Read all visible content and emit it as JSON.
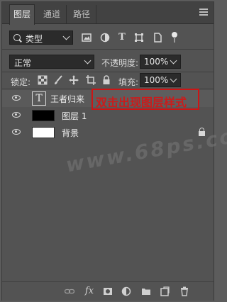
{
  "tabs": [
    {
      "label": "图层",
      "active": true
    },
    {
      "label": "通道",
      "active": false
    },
    {
      "label": "路径",
      "active": false
    }
  ],
  "filter": {
    "type_label": "类型",
    "icons": [
      "image-filter-icon",
      "adjustment-filter-icon",
      "text-filter-icon",
      "shape-filter-icon",
      "smart-object-filter-icon"
    ]
  },
  "blend": {
    "mode": "正常",
    "opacity_label": "不透明度:",
    "opacity_value": "100%"
  },
  "locks": {
    "label": "锁定:",
    "fill_label": "填充:",
    "fill_value": "100%"
  },
  "layers": [
    {
      "name": "王者归来",
      "kind": "text",
      "visible": true,
      "thumb_glyph": "T"
    },
    {
      "name": "图层 1",
      "kind": "pixel",
      "visible": true,
      "thumb_color": "#000000"
    },
    {
      "name": "背景",
      "kind": "background",
      "visible": true,
      "thumb_color": "#ffffff",
      "locked": true
    }
  ],
  "annotation": {
    "text": "双击出现图层样式",
    "color": "#cc1515"
  },
  "watermark": "www.68ps.com",
  "bottom_icons": {
    "fx_label": "fx",
    "names": [
      "link-icon",
      "fx-icon",
      "mask-icon",
      "adjustment-icon",
      "folder-icon",
      "new-layer-icon",
      "trash-icon"
    ]
  }
}
